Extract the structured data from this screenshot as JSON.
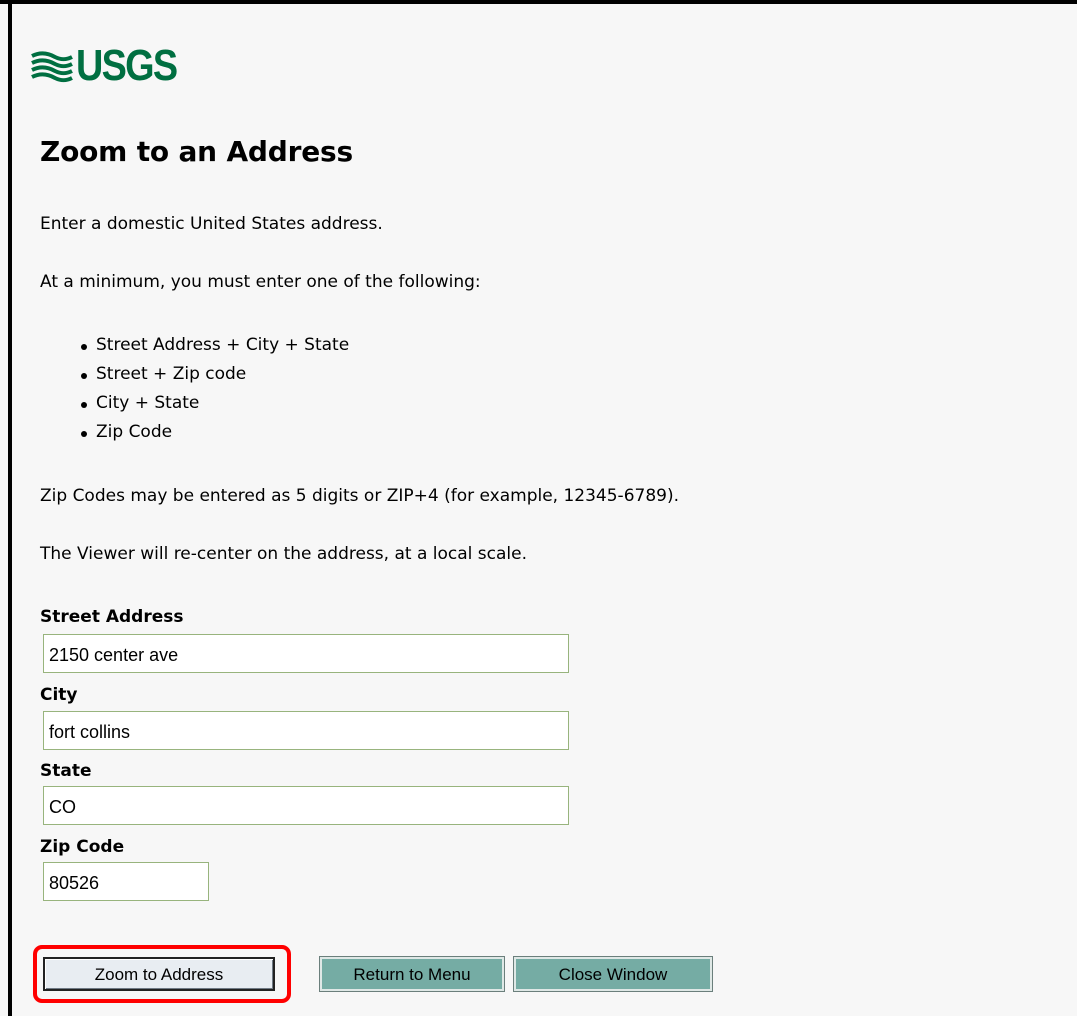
{
  "header": {
    "logo_text": "USGS",
    "logo_icon": "usgs-wave-icon",
    "brand_color": "#006f41"
  },
  "page": {
    "title": "Zoom to an Address",
    "intro": "Enter a domestic United States address.",
    "minimum_requirement": "At a minimum, you must enter one of the following:",
    "requirements": [
      "Street Address + City + State",
      "Street + Zip code",
      "City + State",
      "Zip Code"
    ],
    "zip_note": "Zip Codes may be entered as 5 digits or ZIP+4 (for example, 12345-6789).",
    "viewer_note": "The Viewer will re-center on the address, at a local scale."
  },
  "form": {
    "street_address": {
      "label": "Street Address",
      "value": "2150 center ave"
    },
    "city": {
      "label": "City",
      "value": "fort collins"
    },
    "state": {
      "label": "State",
      "value": "CO"
    },
    "zip_code": {
      "label": "Zip Code",
      "value": "80526"
    }
  },
  "buttons": {
    "zoom_to_address": "Zoom to Address",
    "return_to_menu": "Return to Menu",
    "close_window": "Close Window"
  },
  "colors": {
    "highlight": "#ff0000",
    "button_teal": "#75aca4",
    "field_border": "#98b47d"
  }
}
